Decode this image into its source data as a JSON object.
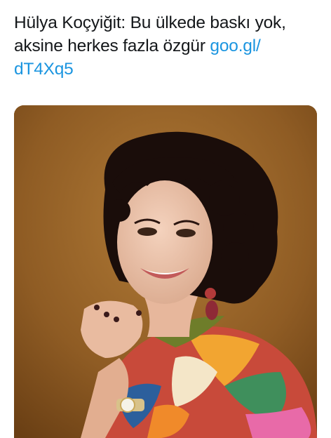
{
  "tweet": {
    "text": "Hülya Koçyiğit: Bu ülkede baskı yok, aksine herkes fazla özgür ",
    "link_text": "goo.gl/",
    "link_text_2": "dT4Xq5"
  },
  "media": {
    "photo_icon": "photo-portrait"
  },
  "colors": {
    "text": "#14171a",
    "link": "#1b95e0",
    "background": "#ffffff",
    "photo_bg": "#8a5a22"
  }
}
